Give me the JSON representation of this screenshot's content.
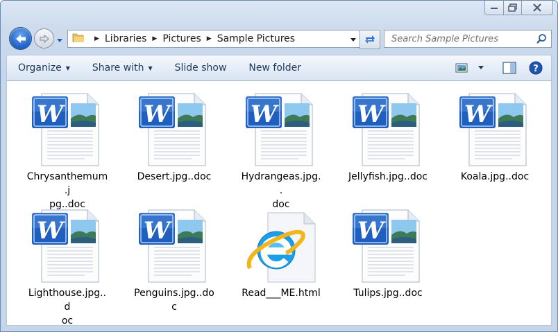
{
  "window": {
    "caption": {
      "minimize_icon": "minimize-icon",
      "maximize_icon": "maximize-icon",
      "close_icon": "close-icon"
    }
  },
  "nav": {
    "breadcrumb": [
      "Libraries",
      "Pictures",
      "Sample Pictures"
    ],
    "search_placeholder": "Search Sample Pictures"
  },
  "toolbar": {
    "organize": "Organize",
    "share_with": "Share with",
    "slide_show": "Slide show",
    "new_folder": "New folder"
  },
  "files": [
    {
      "name": "Chrysanthemum.jpg..doc",
      "line1": "Chrysanthemum.j",
      "line2": "pg..doc",
      "type": "word-doc-icon"
    },
    {
      "name": "Desert.jpg..doc",
      "line1": "Desert.jpg..doc",
      "line2": "",
      "type": "word-doc-icon"
    },
    {
      "name": "Hydrangeas.jpg..doc",
      "line1": "Hydrangeas.jpg..",
      "line2": "doc",
      "type": "word-doc-icon"
    },
    {
      "name": "Jellyfish.jpg..doc",
      "line1": "Jellyfish.jpg..doc",
      "line2": "",
      "type": "word-doc-icon"
    },
    {
      "name": "Koala.jpg..doc",
      "line1": "Koala.jpg..doc",
      "line2": "",
      "type": "word-doc-icon"
    },
    {
      "name": "Lighthouse.jpg..doc",
      "line1": "Lighthouse.jpg..d",
      "line2": "oc",
      "type": "word-doc-icon"
    },
    {
      "name": "Penguins.jpg..doc",
      "line1": "Penguins.jpg..doc",
      "line2": "",
      "type": "word-doc-icon"
    },
    {
      "name": "Read___ME.html",
      "line1": "Read___ME.html",
      "line2": "",
      "type": "internet-explorer-icon"
    },
    {
      "name": "Tulips.jpg..doc",
      "line1": "Tulips.jpg..doc",
      "line2": "",
      "type": "word-doc-icon"
    }
  ],
  "colors": {
    "accent": "#1e5fc4",
    "word_blue": "#1f5fbf",
    "ie_blue": "#1aa0e8",
    "ie_ring": "#f2b51c"
  }
}
